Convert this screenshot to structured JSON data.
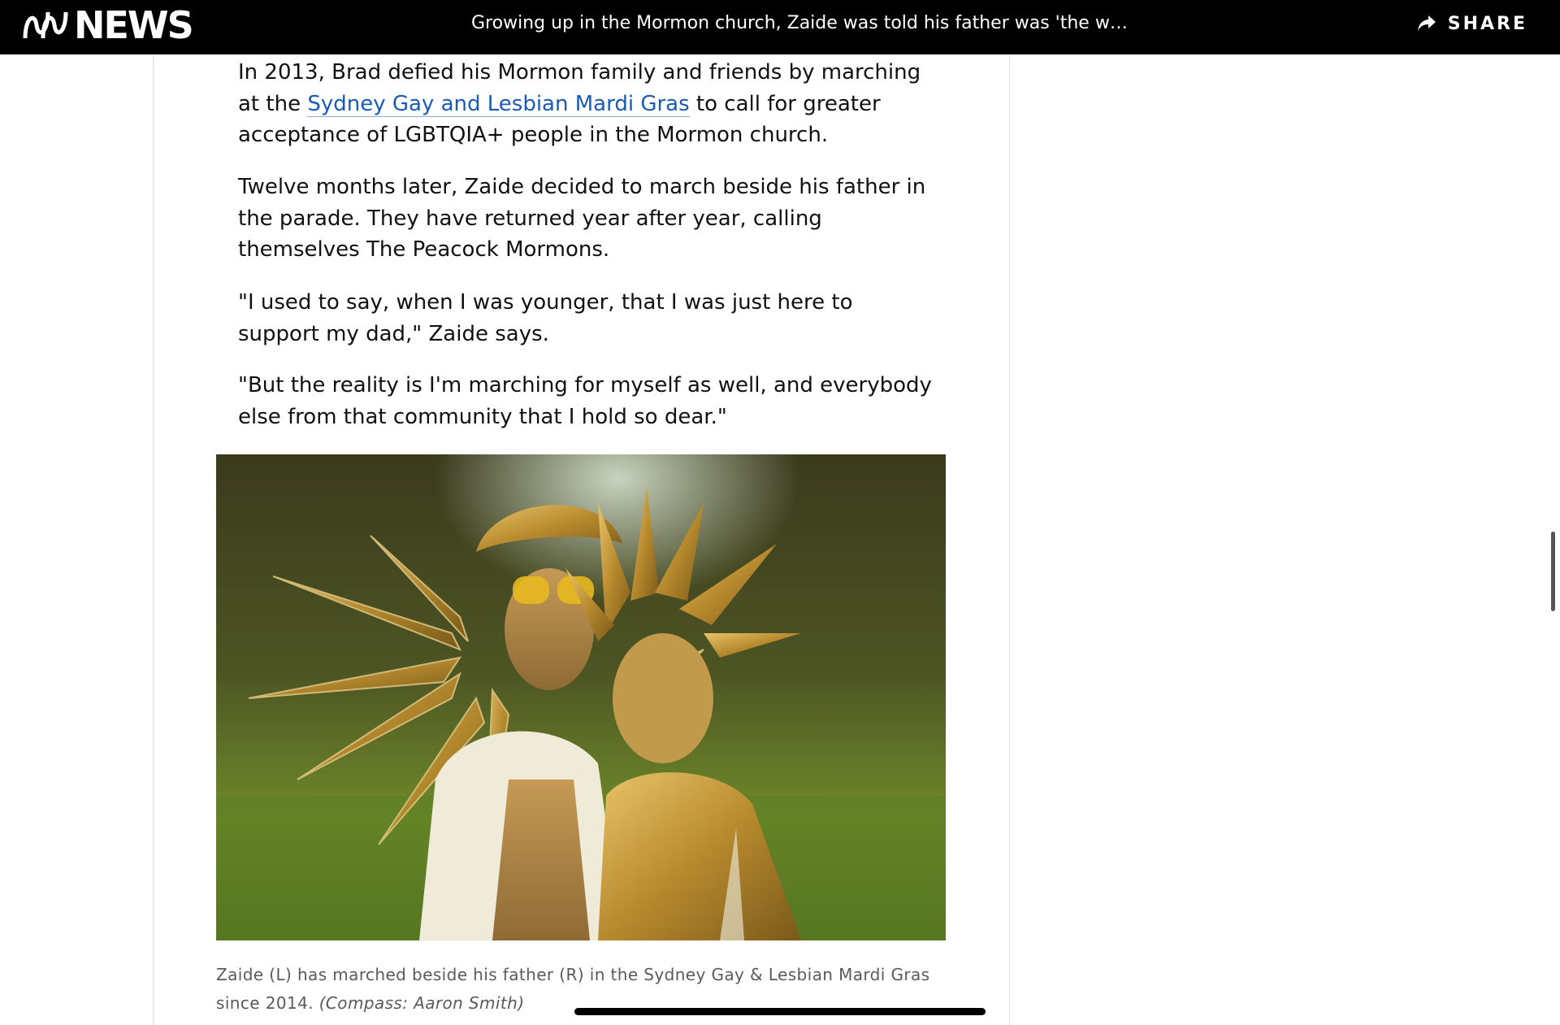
{
  "header": {
    "logo_text": "NEWS",
    "headline": "Growing up in the Mormon church, Zaide was told his father was 'the wor...",
    "share_label": "SHARE"
  },
  "article": {
    "p1": {
      "before": "In 2013, Brad defied his Mormon family and friends by marching at the ",
      "link": "Sydney Gay and Lesbian Mardi Gras",
      "after": " to call for greater acceptance of LGBTQIA+ people in the Mormon church."
    },
    "p2": "Twelve months later, Zaide decided to march beside his father in the parade. They have returned year after year, calling themselves The Peacock Mormons.",
    "p3": "\"I used to say, when I was younger, that I was just here to support my dad,\" Zaide says.",
    "p4": "\"But the reality is I'm marching for myself as well, and everybody else from that community that I hold so dear.\"",
    "caption": {
      "text": "Zaide (L) has marched beside his father (R) in the Sydney Gay & Lesbian Mardi Gras since 2014. ",
      "credit": "(Compass: Aaron Smith)"
    }
  },
  "colors": {
    "topbar": "#000000",
    "link": "#1a5bb8",
    "caption": "#5a5a5a"
  },
  "icons": {
    "logo": "abc-logo-icon",
    "share": "share-arrow-icon"
  }
}
